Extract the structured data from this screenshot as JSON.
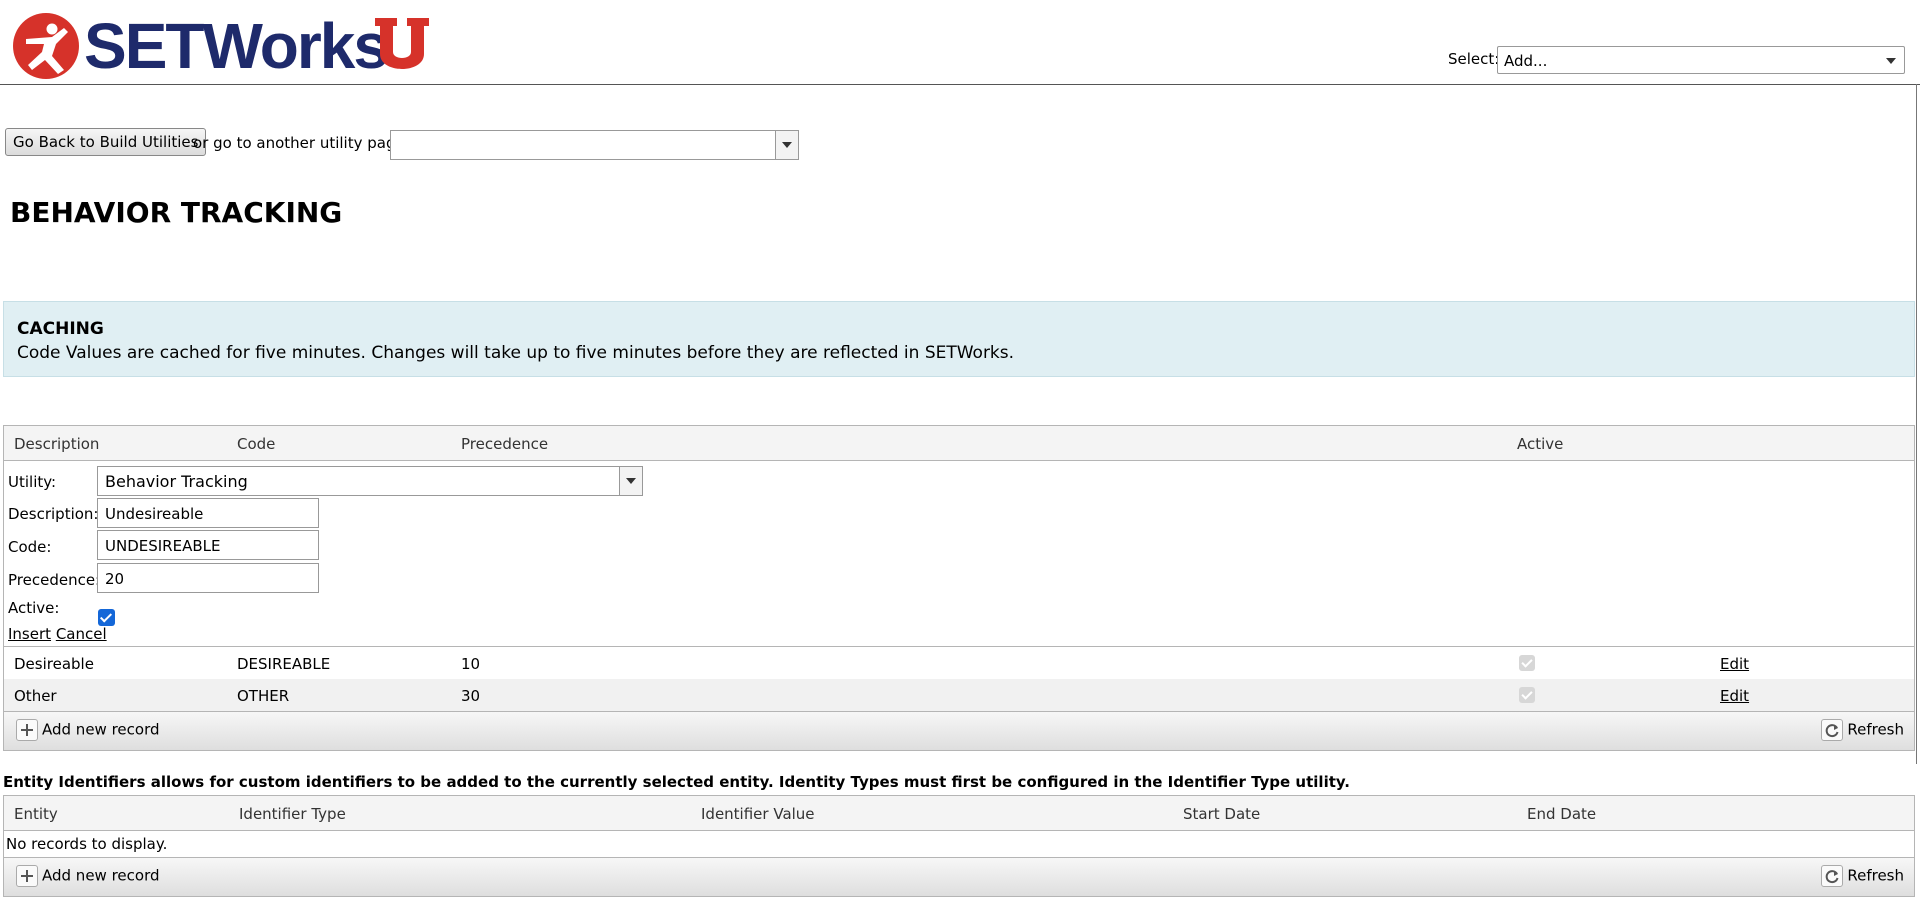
{
  "header": {
    "logo_text": "SETWorks",
    "select_label": "Select:",
    "select_value": "Add...",
    "colors": {
      "brand_navy": "#1e2a6b",
      "brand_red": "#d6322a"
    }
  },
  "nav": {
    "back_button": "Go Back to Build Utilities",
    "goto_label": "or go to another utility page:",
    "goto_value": ""
  },
  "page_title": "BEHAVIOR TRACKING",
  "caching": {
    "heading": "CACHING",
    "text": "Code Values are cached for five minutes. Changes will take up to five minutes before they are reflected in SETWorks."
  },
  "code_grid": {
    "columns": [
      "Description",
      "Code",
      "Precedence",
      "Active"
    ],
    "form": {
      "utility_label": "Utility:",
      "utility_value": "Behavior Tracking",
      "description_label": "Description:",
      "description_value": "Undesireable",
      "code_label": "Code:",
      "code_value": "UNDESIREABLE",
      "precedence_label": "Precedence:",
      "precedence_value": "20",
      "active_label": "Active:",
      "active_checked": true,
      "insert": "Insert",
      "cancel": "Cancel"
    },
    "rows": [
      {
        "description": "Desireable",
        "code": "DESIREABLE",
        "precedence": "10",
        "active": true,
        "action": "Edit"
      },
      {
        "description": "Other",
        "code": "OTHER",
        "precedence": "30",
        "active": true,
        "action": "Edit"
      }
    ],
    "add_label": "Add new record",
    "refresh_label": "Refresh"
  },
  "entity": {
    "note": "Entity Identifiers allows for custom identifiers to be added to the currently selected entity. Identity Types must first be configured in the Identifier Type utility.",
    "columns": [
      "Entity",
      "Identifier Type",
      "Identifier Value",
      "Start Date",
      "End Date"
    ],
    "empty_text": "No records to display.",
    "add_label": "Add new record",
    "refresh_label": "Refresh"
  }
}
